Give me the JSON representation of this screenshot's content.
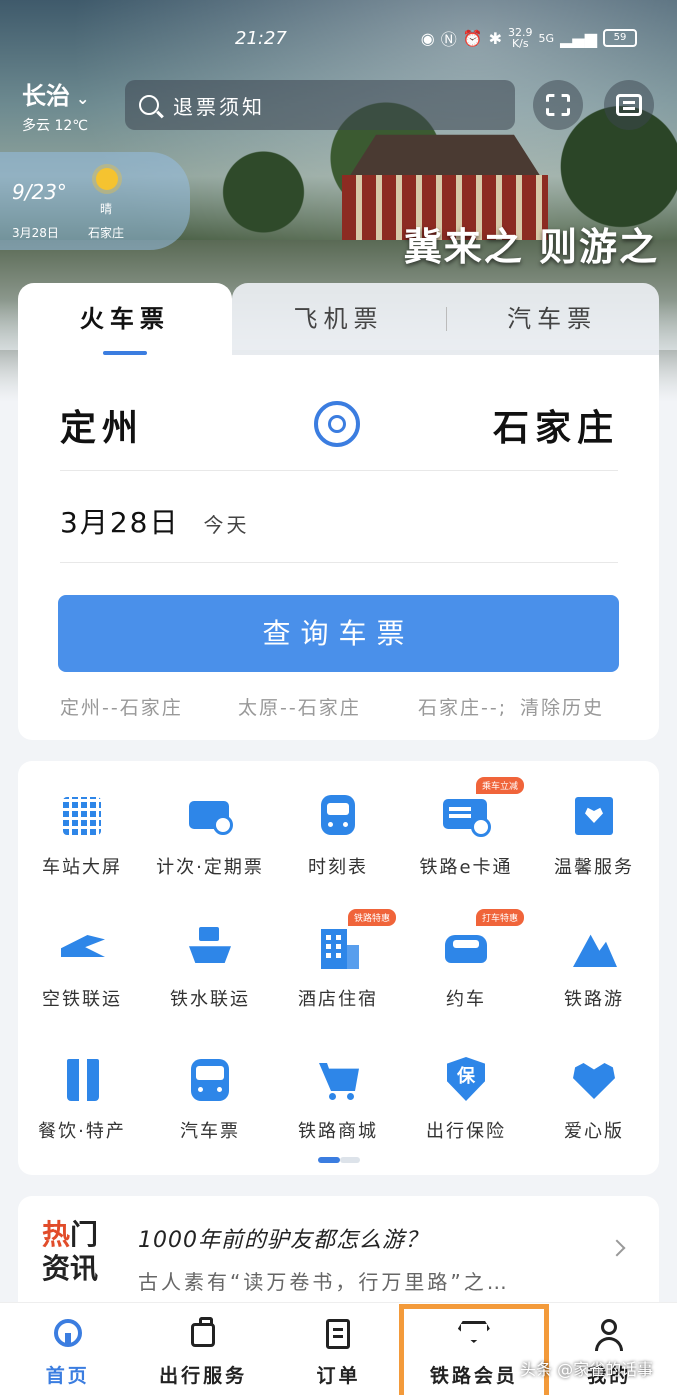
{
  "status_bar": {
    "time": "21:27",
    "speed_value": "32.9",
    "speed_unit": "K/s",
    "signal": "5G",
    "battery": "59"
  },
  "header": {
    "city": "长治",
    "weather_line": "多云 12℃",
    "search_placeholder": "退票须知"
  },
  "weather_card": {
    "temp": "9/23°",
    "condition": "晴",
    "date": "3月28日",
    "place": "石家庄"
  },
  "banner": {
    "slogan": "冀来之 则游之"
  },
  "ticket": {
    "tabs": [
      {
        "label": "火车票",
        "active": true
      },
      {
        "label": "飞机票",
        "active": false
      },
      {
        "label": "汽车票",
        "active": false
      }
    ],
    "from": "定州",
    "to": "石家庄",
    "date": "3月28日",
    "date_note": "今天",
    "query_label": "查询车票",
    "history": [
      "定州--石家庄",
      "太原--石家庄",
      "石家庄--;"
    ],
    "clear_label": "清除历史"
  },
  "services": {
    "items": [
      {
        "label": "车站大屏",
        "icon": "station-screen-icon"
      },
      {
        "label": "计次·定期票",
        "icon": "ticket-card-icon"
      },
      {
        "label": "时刻表",
        "icon": "train-icon"
      },
      {
        "label": "铁路e卡通",
        "icon": "ecard-icon",
        "badge": "乘车立减"
      },
      {
        "label": "温馨服务",
        "icon": "warm-service-icon"
      },
      {
        "label": "空铁联运",
        "icon": "plane-train-icon"
      },
      {
        "label": "铁水联运",
        "icon": "ship-train-icon"
      },
      {
        "label": "酒店住宿",
        "icon": "hotel-icon",
        "badge": "铁路特惠"
      },
      {
        "label": "约车",
        "icon": "car-icon",
        "badge": "打车特惠"
      },
      {
        "label": "铁路游",
        "icon": "mountain-icon"
      },
      {
        "label": "餐饮·特产",
        "icon": "food-icon"
      },
      {
        "label": "汽车票",
        "icon": "bus-icon"
      },
      {
        "label": "铁路商城",
        "icon": "cart-icon"
      },
      {
        "label": "出行保险",
        "icon": "insurance-icon",
        "glyph": "保"
      },
      {
        "label": "爱心版",
        "icon": "heart-icon"
      }
    ]
  },
  "news": {
    "tag_line1": "热门",
    "tag_line2": "资讯",
    "title": "1000年前的驴友都怎么游？",
    "desc": "古人素有“读万卷书，行万里路”之…"
  },
  "bottom_nav": {
    "items": [
      {
        "label": "首页",
        "icon": "home-icon",
        "active": true
      },
      {
        "label": "出行服务",
        "icon": "luggage-icon",
        "active": false
      },
      {
        "label": "订单",
        "icon": "order-icon",
        "active": false
      },
      {
        "label": "铁路会员",
        "icon": "diamond-icon",
        "active": false
      },
      {
        "label": "我的",
        "icon": "user-icon",
        "active": false
      }
    ]
  },
  "watermark": "头条 @家雀的话事",
  "colors": {
    "accent": "#3b7de0",
    "button": "#4a90ea",
    "icon_blue": "#2e86e8",
    "badge": "#f0643a",
    "highlight": "#f39a3a"
  }
}
